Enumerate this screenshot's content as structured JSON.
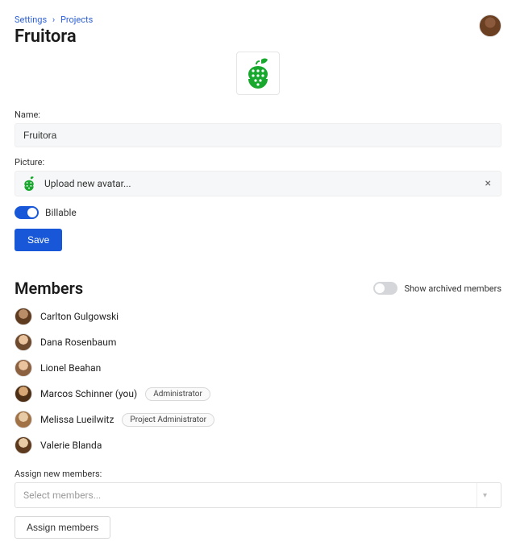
{
  "breadcrumb": {
    "settings": "Settings",
    "sep": "›",
    "projects": "Projects"
  },
  "page_title": "Fruitora",
  "form": {
    "name_label": "Name:",
    "name_value": "Fruitora",
    "picture_label": "Picture:",
    "upload_text": "Upload new avatar...",
    "billable_label": "Billable",
    "billable_on": true,
    "save_label": "Save"
  },
  "members_section": {
    "title": "Members",
    "archived_label": "Show archived members",
    "archived_on": false
  },
  "members": [
    {
      "name": "Carlton Gulgowski",
      "role": null,
      "avatar": "av-a"
    },
    {
      "name": "Dana Rosenbaum",
      "role": null,
      "avatar": "av-b"
    },
    {
      "name": "Lionel Beahan",
      "role": null,
      "avatar": "av-c"
    },
    {
      "name": "Marcos Schinner (you)",
      "role": "Administrator",
      "avatar": "av-d"
    },
    {
      "name": "Melissa Lueilwitz",
      "role": "Project Administrator",
      "avatar": "av-e"
    },
    {
      "name": "Valerie Blanda",
      "role": null,
      "avatar": "av-f"
    }
  ],
  "assign": {
    "label": "Assign new members:",
    "placeholder": "Select members...",
    "button": "Assign members"
  }
}
